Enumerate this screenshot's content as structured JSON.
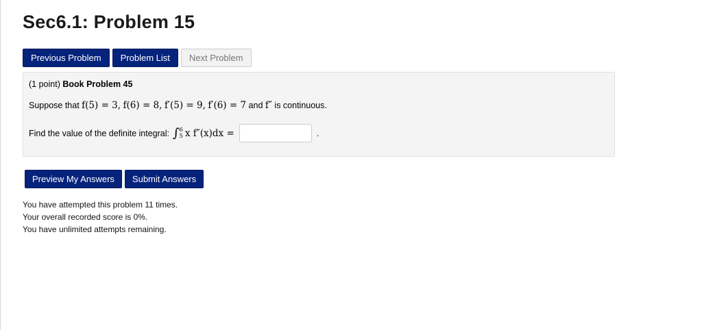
{
  "page": {
    "title": "Sec6.1: Problem 15"
  },
  "nav": {
    "previous_label": "Previous Problem",
    "list_label": "Problem List",
    "next_label": "Next Problem"
  },
  "problem": {
    "points": "(1 point)",
    "book_label": "Book Problem 45",
    "statement_prefix": "Suppose that",
    "f5": "f(5) = 3,",
    "f6": "f(6) = 8,",
    "fp5": "f′(5) = 9,",
    "fp6": "f′(6) = 7",
    "and_word": "and",
    "fpp": "f″",
    "continuous_text": "is continuous.",
    "find_text": "Find the value of the definite integral:",
    "integral_upper": "6",
    "integral_lower": "5",
    "integrand": "x f″(x)dx =",
    "answer_value": "",
    "period": "."
  },
  "actions": {
    "preview_label": "Preview My Answers",
    "submit_label": "Submit Answers"
  },
  "status": {
    "attempts": "You have attempted this problem 11 times.",
    "score": "Your overall recorded score is 0%.",
    "remaining": "You have unlimited attempts remaining."
  },
  "colors": {
    "primary_button": "#06237c",
    "disabled_button": "#f2f2f2",
    "problem_background": "#f4f4f4"
  }
}
